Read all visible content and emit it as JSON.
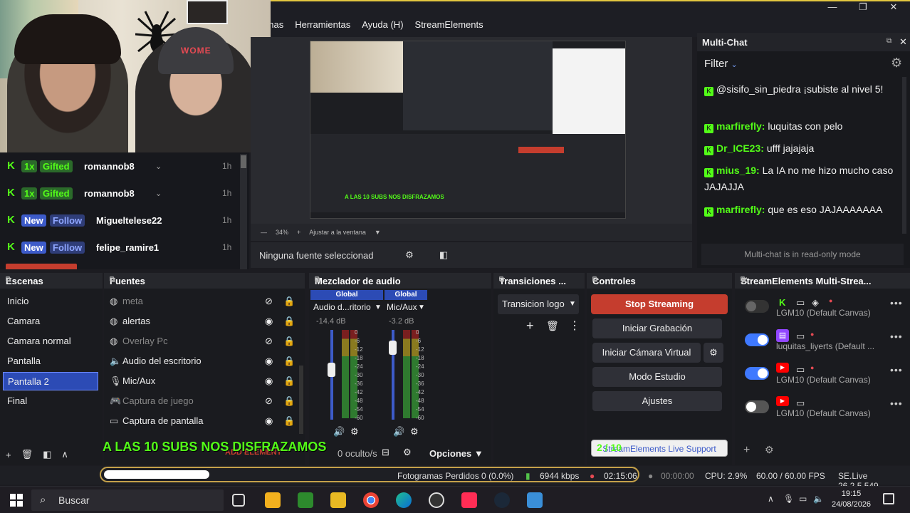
{
  "menu": [
    "enas",
    "Herramientas",
    "Ayuda (H)",
    "StreamElements"
  ],
  "window_controls": [
    "minimize-icon",
    "restore-icon",
    "close-icon"
  ],
  "webcam": {
    "beanie_text": "WOME"
  },
  "events": [
    {
      "badge": "1x",
      "type": "Gifted",
      "name": "romannob8",
      "time": "1h"
    },
    {
      "badge": "1x",
      "type": "Gifted",
      "name": "romannob8",
      "time": "1h"
    },
    {
      "badge": "New",
      "type": "Follow",
      "name": "Migueltelese22",
      "time": "1h"
    },
    {
      "badge": "New",
      "type": "Follow",
      "name": "felipe_ramire1",
      "time": "1h"
    }
  ],
  "preview": {
    "zoom": "34%",
    "fit": "Ajustar a la ventana",
    "overlay": "A LAS 10 SUBS NOS DISFRAZAMOS",
    "no_source": "Ninguna fuente seleccionad"
  },
  "multichat": {
    "title": "Multi-Chat",
    "filter": "Filter",
    "messages": [
      {
        "user": "",
        "text": "@sisifo_sin_piedra ¡subiste al nivel 5!"
      },
      {
        "user": "marfirefly:",
        "text": "luquitas con pelo"
      },
      {
        "user": "Dr_ICE23:",
        "text": "ufff jajajaja"
      },
      {
        "user": "mius_19:",
        "text": "La IA no me hizo mucho caso JAJAJJA"
      },
      {
        "user": "marfirefly:",
        "text": "que es eso JAJAAAAAAA"
      }
    ],
    "readonly": "Multi-chat is in read-only mode"
  },
  "scenes": {
    "title": "Escenas",
    "items": [
      "Inicio",
      "Camara",
      "Camara normal",
      "Pantalla",
      "Pantalla 2",
      "Final"
    ],
    "selected": 4
  },
  "sources": {
    "title": "Fuentes",
    "items": [
      {
        "name": "meta",
        "visible": false
      },
      {
        "name": "alertas",
        "visible": true
      },
      {
        "name": "Overlay Pc",
        "visible": false
      },
      {
        "name": "Audio del escritorio",
        "visible": true
      },
      {
        "name": "Mic/Aux",
        "visible": true
      },
      {
        "name": "Captura de juego",
        "visible": false
      },
      {
        "name": "Captura de pantalla",
        "visible": true
      }
    ],
    "add": "ADD ELEMENT"
  },
  "mixer": {
    "title": "Mezclador de audio",
    "global1": "Global",
    "global2": "Global",
    "ch1": "Audio d...ritorio",
    "ch2": "Mic/Aux",
    "db1": "-14.4 dB",
    "db2": "-3.2 dB",
    "scale": [
      "0",
      "-6",
      "-12",
      "-18",
      "-24",
      "-30",
      "-36",
      "-42",
      "-48",
      "-54",
      "-60"
    ],
    "hidden": "0 oculto/s",
    "options": "Opciones"
  },
  "transitions": {
    "title": "Transiciones ...",
    "value": "Transicion logo"
  },
  "controls": {
    "title": "Controles",
    "buttons": [
      "Stop Streaming",
      "Iniciar Grabación",
      "Iniciar Cámara Virtual",
      "Modo Estudio",
      "Ajustes"
    ],
    "support": "StreamElements Live Support",
    "counter": "2 / 10"
  },
  "se": {
    "title": "StreamElements Multi-Strea...",
    "outputs": [
      {
        "on": false,
        "platform": "kick",
        "name": "LGM10 (Default Canvas)"
      },
      {
        "on": true,
        "platform": "twitch",
        "name": "luquitas_liyerts (Default ..."
      },
      {
        "on": true,
        "platform": "youtube",
        "name": "LGM10 (Default Canvas)"
      },
      {
        "on": false,
        "platform": "youtube",
        "name": "LGM10 (Default Canvas)"
      }
    ]
  },
  "status": {
    "dropped": "Fotogramas Perdidos 0 (0.0%)",
    "kbps": "6944 kbps",
    "live_time": "02:15:06",
    "rec_time": "00:00:00",
    "cpu": "CPU: 2.9%",
    "fps": "60.00 / 60.00 FPS",
    "version": "SE.Live 26.2.5.549"
  },
  "progress": 0.2,
  "taskbar": {
    "search": "Buscar",
    "time": "19:15",
    "date": "24/08/2026"
  },
  "colors": {
    "kick": "#53fc18",
    "accent": "#2c4bb5",
    "stop": "#c53d2e"
  }
}
